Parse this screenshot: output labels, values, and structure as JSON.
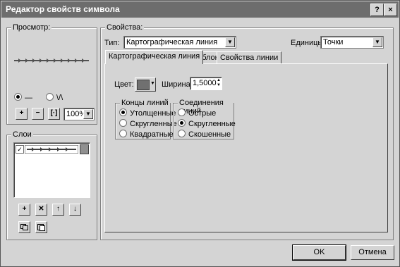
{
  "window": {
    "title": "Редактор свойств символа"
  },
  "titlebar_buttons": {
    "help": "?",
    "close": "×"
  },
  "preview": {
    "label": "Просмотр:",
    "radio_line": "—",
    "radio_zigzag": "\\/\\",
    "zoom_in": "+",
    "zoom_out": "−",
    "fit": "[·]",
    "zoom_value": "100%"
  },
  "layers": {
    "label": "Слои",
    "add": "+",
    "remove": "✕",
    "up": "↑",
    "down": "↓"
  },
  "properties": {
    "label": "Свойства:",
    "type_label": "Тип:",
    "type_value": "Картографическая линия",
    "units_label": "Единицы:",
    "units_value": "Точки"
  },
  "tabs": [
    {
      "label": "Картографическая линия"
    },
    {
      "label": "Шаблон"
    },
    {
      "label": "Свойства линии"
    }
  ],
  "cartographic": {
    "color_label": "Цвет:",
    "color_value": "#707070",
    "width_label": "Ширина:",
    "width_value": "1,5000"
  },
  "line_caps": {
    "label": "Концы линий",
    "options": [
      "Утолщенные",
      "Скругленные",
      "Квадратные"
    ],
    "selected": 0
  },
  "line_joins": {
    "label": "Соединения линий",
    "options": [
      "Острые",
      "Скругленные",
      "Скошенные"
    ],
    "selected": 1
  },
  "footer": {
    "ok": "OK",
    "cancel": "Отмена"
  }
}
